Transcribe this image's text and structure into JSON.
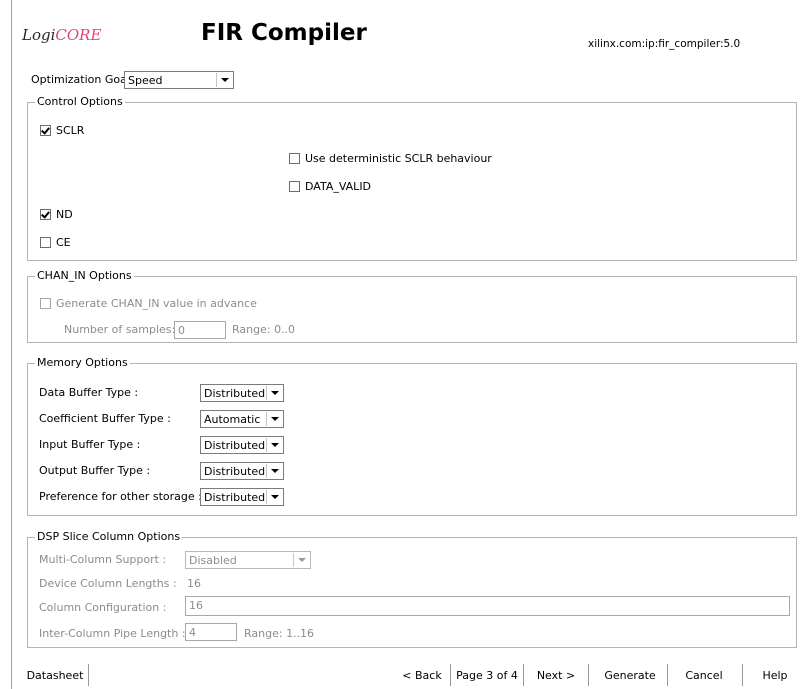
{
  "header": {
    "logo_prefix": "Logi",
    "logo_core": "CORE",
    "title": "FIR Compiler",
    "ip_id": "xilinx.com:ip:fir_compiler:5.0"
  },
  "optimization": {
    "label": "Optimization Goal",
    "value": "Speed"
  },
  "control_options": {
    "title": "Control Options",
    "sclr": "SCLR",
    "deterministic": "Use deterministic SCLR behaviour",
    "data_valid": "DATA_VALID",
    "nd": "ND",
    "ce": "CE"
  },
  "chan_in": {
    "title": "CHAN_IN Options",
    "generate": "Generate CHAN_IN value in advance",
    "samples_label": "Number of samples:",
    "samples_value": "0",
    "range": "Range: 0..0"
  },
  "memory": {
    "title": "Memory Options",
    "rows": [
      {
        "label": "Data Buffer Type :",
        "value": "Distributed"
      },
      {
        "label": "Coefficient Buffer Type :",
        "value": "Automatic"
      },
      {
        "label": "Input Buffer Type :",
        "value": "Distributed"
      },
      {
        "label": "Output Buffer Type :",
        "value": "Distributed"
      },
      {
        "label": "Preference for other storage :",
        "value": "Distributed"
      }
    ]
  },
  "dsp": {
    "title": "DSP Slice Column Options",
    "multi_label": "Multi-Column Support :",
    "multi_value": "Disabled",
    "lengths_label": "Device Column Lengths :",
    "lengths_value": "16",
    "config_label": "Column Configuration :",
    "config_value": "16",
    "pipe_label": "Inter-Column Pipe Length :",
    "pipe_value": "4",
    "pipe_range": "Range: 1..16"
  },
  "footer": {
    "datasheet": "Datasheet",
    "back": "< Back",
    "page": "Page 3 of 4",
    "next": "Next >",
    "generate": "Generate",
    "cancel": "Cancel",
    "help": "Help"
  },
  "checkbox_states": {
    "sclr": true,
    "deterministic": false,
    "data_valid": false,
    "nd": true,
    "ce": false,
    "generate_chan_in": false
  },
  "colors": {
    "logo_accent": "#e0457b",
    "disabled_text": "#8c8c8c",
    "group_border": "#b5b5b5"
  }
}
